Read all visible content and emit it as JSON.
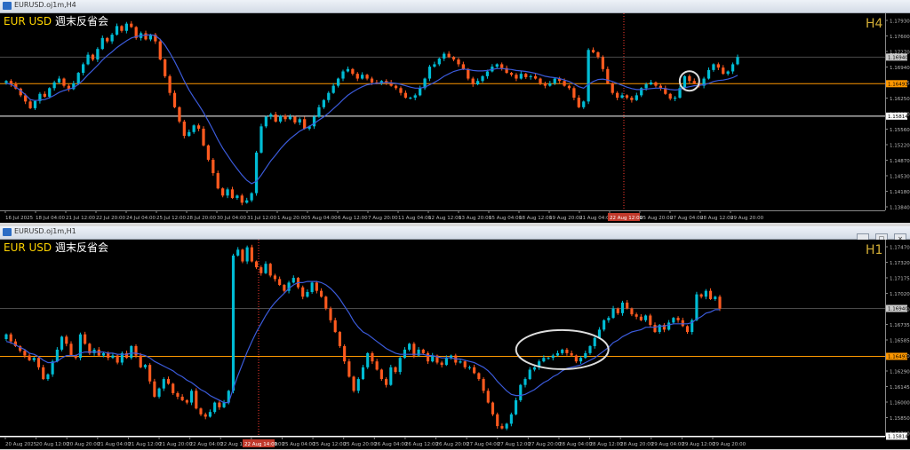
{
  "colors": {
    "background": "#000000",
    "bull": "#00bcd4",
    "bear": "#ff5a1f",
    "ma": "#3b5bdb",
    "hline_orange": "#ff9800",
    "hline_white": "#ffffff",
    "symbol_text": "#ffd400",
    "timeframe_text": "#d4af37"
  },
  "icons": {
    "window_minimize": "minimize-icon",
    "window_restore": "restore-icon",
    "window_close": "close-icon"
  },
  "top_window": {
    "title": "EURUSD.oj1m,H4",
    "symbol": "EUR USD",
    "subtitle": "週末反省会",
    "timeframe": "H4"
  },
  "bottom_window": {
    "title": "EURUSD.oj1m,H1",
    "symbol": "EUR USD",
    "subtitle": "週末反省会",
    "timeframe": "H1",
    "buttons": [
      "_",
      "□",
      "×"
    ]
  },
  "chart_data": [
    {
      "type": "candlestick",
      "timeframe": "H4",
      "ylim": [
        1.1384,
        1.1793
      ],
      "y_ticks": [
        "1.17930",
        "1.17600",
        "1.17270",
        "1.16940",
        "1.16605",
        "1.16250",
        "1.15920",
        "1.15560",
        "1.15220",
        "1.14870",
        "1.14530",
        "1.14180",
        "1.13840"
      ],
      "x_labels": [
        "16 Jul 2025",
        "18 Jul 04:00",
        "21 Jul 12:00",
        "22 Jul 20:00",
        "24 Jul 04:00",
        "25 Jul 12:00",
        "28 Jul 20:00",
        "30 Jul 04:00",
        "31 Jul 12:00",
        "1 Aug 20:00",
        "5 Aug 04:00",
        "6 Aug 12:00",
        "7 Aug 20:00",
        "11 Aug 04:00",
        "12 Aug 12:00",
        "13 Aug 20:00",
        "15 Aug 04:00",
        "18 Aug 12:00",
        "19 Aug 20:00",
        "21 Aug 04:00",
        "22 Aug 12:00",
        "25 Aug 20:00",
        "27 Aug 04:00",
        "28 Aug 12:00",
        "29 Aug 20:00"
      ],
      "x_highlight_label": "22 Aug 12:00",
      "price_labels": {
        "current": "1.16940",
        "orange_level": "1.16493",
        "white_level": "1.15814"
      },
      "levels": {
        "orange": 1.16493,
        "white": 1.15814
      },
      "close": [
        1.1655,
        1.1648,
        1.1639,
        1.1625,
        1.1612,
        1.1598,
        1.1613,
        1.1628,
        1.1622,
        1.164,
        1.1652,
        1.166,
        1.1645,
        1.1638,
        1.165,
        1.1672,
        1.169,
        1.171,
        1.17,
        1.1722,
        1.1745,
        1.1738,
        1.1752,
        1.177,
        1.176,
        1.1775,
        1.1768,
        1.1745,
        1.1755,
        1.1742,
        1.1752,
        1.1738,
        1.17,
        1.1665,
        1.163,
        1.16,
        1.157,
        1.154,
        1.1548,
        1.1562,
        1.1555,
        1.152,
        1.149,
        1.1462,
        1.143,
        1.1415,
        1.1428,
        1.141,
        1.1415,
        1.14,
        1.1405,
        1.142,
        1.1505,
        1.156,
        1.158,
        1.1585,
        1.157,
        1.1582,
        1.1575,
        1.158,
        1.1568,
        1.1575,
        1.1555,
        1.156,
        1.158,
        1.16,
        1.1615,
        1.163,
        1.1645,
        1.166,
        1.1675,
        1.168,
        1.167,
        1.166,
        1.1668,
        1.166,
        1.1652,
        1.165,
        1.1655,
        1.1652,
        1.1645,
        1.164,
        1.163,
        1.162,
        1.162,
        1.1625,
        1.164,
        1.166,
        1.1685,
        1.169,
        1.1702,
        1.1712,
        1.1705,
        1.17,
        1.169,
        1.168,
        1.166,
        1.1648,
        1.1655,
        1.1665,
        1.1675,
        1.1685,
        1.169,
        1.1682,
        1.1672,
        1.1668,
        1.166,
        1.167,
        1.1663,
        1.1665,
        1.166,
        1.165,
        1.1645,
        1.165,
        1.166,
        1.1655,
        1.1645,
        1.164,
        1.162,
        1.16,
        1.1612,
        1.172,
        1.1715,
        1.1705,
        1.168,
        1.165,
        1.163,
        1.162,
        1.1625,
        1.162,
        1.1615,
        1.1625,
        1.164,
        1.1648,
        1.1652,
        1.1645,
        1.164,
        1.1628,
        1.1618,
        1.162,
        1.164,
        1.1665,
        1.1655,
        1.165,
        1.1645,
        1.166,
        1.1678,
        1.169,
        1.1683,
        1.167,
        1.1675,
        1.169,
        1.1705
      ],
      "ma": [
        1.165,
        1.1648,
        1.1642,
        1.1635,
        1.1626,
        1.1616,
        1.1614,
        1.1615,
        1.1616,
        1.162,
        1.1625,
        1.1631,
        1.1635,
        1.1638,
        1.1641,
        1.1648,
        1.1657,
        1.1668,
        1.1678,
        1.1688,
        1.1699,
        1.1708,
        1.1716,
        1.1725,
        1.1732,
        1.1739,
        1.1745,
        1.1748,
        1.175,
        1.1751,
        1.1752,
        1.175,
        1.1742,
        1.173,
        1.1714,
        1.1696,
        1.1676,
        1.1655,
        1.1636,
        1.162,
        1.1605,
        1.1589,
        1.1571,
        1.1552,
        1.1532,
        1.1514,
        1.1499,
        1.1484,
        1.1471,
        1.1458,
        1.1447,
        1.144,
        1.1445,
        1.1458,
        1.1473,
        1.1488,
        1.15,
        1.1513,
        1.1524,
        1.1534,
        1.1542,
        1.155,
        1.1555,
        1.156,
        1.1566,
        1.1573,
        1.158,
        1.1588,
        1.1597,
        1.1606,
        1.1616,
        1.1625,
        1.1632,
        1.1638,
        1.1643,
        1.1647,
        1.1649,
        1.165,
        1.1651,
        1.1652,
        1.1651,
        1.165,
        1.1648,
        1.1645,
        1.1642,
        1.164,
        1.164,
        1.1642,
        1.1647,
        1.1652,
        1.1658,
        1.1665,
        1.167,
        1.1675,
        1.1678,
        1.168,
        1.1679,
        1.1677,
        1.1676,
        1.1676,
        1.1677,
        1.1679,
        1.1681,
        1.1681,
        1.168,
        1.1679,
        1.1677,
        1.1676,
        1.1675,
        1.1673,
        1.1671,
        1.1668,
        1.1665,
        1.1663,
        1.1662,
        1.166,
        1.1657,
        1.1654,
        1.1649,
        1.1643,
        1.164,
        1.1648,
        1.1654,
        1.1658,
        1.1659,
        1.1657,
        1.1654,
        1.165,
        1.1646,
        1.1642,
        1.1639,
        1.1637,
        1.1637,
        1.1638,
        1.1639,
        1.164,
        1.164,
        1.1639,
        1.1637,
        1.1636,
        1.1637,
        1.1641,
        1.1643,
        1.1645,
        1.1646,
        1.1647,
        1.165,
        1.1654,
        1.1656,
        1.1657,
        1.1659,
        1.1662,
        1.1667
      ],
      "annotation": "circle"
    },
    {
      "type": "candlestick",
      "timeframe": "H1",
      "ylim": [
        1.1581,
        1.1747
      ],
      "y_ticks": [
        "1.17470",
        "1.17320",
        "1.17175",
        "1.17020",
        "1.16880",
        "1.16735",
        "1.16585",
        "1.16440",
        "1.16290",
        "1.16145",
        "1.16000",
        "1.15850",
        "1.15700"
      ],
      "x_labels": [
        "20 Aug 2025",
        "20 Aug 12:00",
        "20 Aug 20:00",
        "21 Aug 04:00",
        "21 Aug 12:00",
        "21 Aug 20:00",
        "22 Aug 04:00",
        "22 Aug 12:00",
        "22 Aug 20:00",
        "25 Aug 04:00",
        "25 Aug 12:00",
        "25 Aug 20:00",
        "26 Aug 04:00",
        "26 Aug 12:00",
        "26 Aug 20:00",
        "27 Aug 04:00",
        "27 Aug 12:00",
        "27 Aug 20:00",
        "28 Aug 04:00",
        "28 Aug 12:00",
        "28 Aug 20:00",
        "29 Aug 04:00",
        "29 Aug 12:00",
        "29 Aug 20:00"
      ],
      "x_highlight_label": "22 Aug 14:00",
      "price_labels": {
        "current": "1.16940",
        "orange_level": "1.16493",
        "white_level": "1.15814"
      },
      "levels": {
        "orange": 1.16493,
        "white": 1.15814
      },
      "close": [
        1.1668,
        1.1662,
        1.1658,
        1.1654,
        1.165,
        1.1646,
        1.1648,
        1.164,
        1.163,
        1.1634,
        1.1645,
        1.1655,
        1.1666,
        1.166,
        1.165,
        1.1648,
        1.1668,
        1.166,
        1.1652,
        1.1655,
        1.165,
        1.1652,
        1.1648,
        1.165,
        1.1644,
        1.1652,
        1.1648,
        1.1658,
        1.165,
        1.164,
        1.1642,
        1.1628,
        1.1615,
        1.1622,
        1.163,
        1.1626,
        1.1618,
        1.1615,
        1.1612,
        1.161,
        1.162,
        1.1605,
        1.16,
        1.1598,
        1.1602,
        1.161,
        1.1606,
        1.161,
        1.162,
        1.1735,
        1.174,
        1.173,
        1.1742,
        1.173,
        1.1725,
        1.172,
        1.1728,
        1.1718,
        1.1715,
        1.171,
        1.1705,
        1.1712,
        1.1716,
        1.1708,
        1.17,
        1.1704,
        1.1712,
        1.1705,
        1.17,
        1.169,
        1.168,
        1.167,
        1.1658,
        1.1645,
        1.1632,
        1.162,
        1.163,
        1.164,
        1.1652,
        1.1645,
        1.1638,
        1.163,
        1.1625,
        1.164,
        1.1636,
        1.1648,
        1.1655,
        1.166,
        1.165,
        1.1655,
        1.1652,
        1.1645,
        1.165,
        1.1644,
        1.1642,
        1.1648,
        1.165,
        1.1644,
        1.1645,
        1.164,
        1.164,
        1.1635,
        1.163,
        1.162,
        1.161,
        1.16,
        1.159,
        1.1588,
        1.1592,
        1.16,
        1.1612,
        1.1625,
        1.163,
        1.1638,
        1.164,
        1.1645,
        1.1648,
        1.1648,
        1.165,
        1.1652,
        1.1655,
        1.1652,
        1.165,
        1.1645,
        1.1648,
        1.1652,
        1.1658,
        1.1665,
        1.1672,
        1.168,
        1.1682,
        1.169,
        1.1686,
        1.1695,
        1.169,
        1.1685,
        1.1683,
        1.168,
        1.1684,
        1.1676,
        1.167,
        1.1676,
        1.1672,
        1.1678,
        1.1682,
        1.168,
        1.1675,
        1.167,
        1.168,
        1.1702,
        1.17,
        1.1705,
        1.1698,
        1.17,
        1.169
      ],
      "ma": [
        1.1662,
        1.1661,
        1.1659,
        1.1657,
        1.1655,
        1.1652,
        1.1651,
        1.1649,
        1.1646,
        1.1644,
        1.1644,
        1.1645,
        1.1648,
        1.165,
        1.165,
        1.165,
        1.1652,
        1.1653,
        1.1653,
        1.1653,
        1.1653,
        1.1653,
        1.1652,
        1.1652,
        1.1651,
        1.1651,
        1.1651,
        1.1652,
        1.1652,
        1.1651,
        1.165,
        1.1648,
        1.1645,
        1.1643,
        1.1641,
        1.1639,
        1.1637,
        1.1634,
        1.1632,
        1.1629,
        1.1627,
        1.1624,
        1.1621,
        1.1619,
        1.1616,
        1.1614,
        1.1612,
        1.161,
        1.161,
        1.1622,
        1.1633,
        1.1643,
        1.1653,
        1.1662,
        1.167,
        1.1677,
        1.1684,
        1.169,
        1.1695,
        1.1699,
        1.1703,
        1.1707,
        1.171,
        1.1712,
        1.1712,
        1.1713,
        1.1713,
        1.1713,
        1.1712,
        1.171,
        1.1707,
        1.1703,
        1.1698,
        1.1692,
        1.1686,
        1.1679,
        1.1674,
        1.167,
        1.1668,
        1.1665,
        1.1662,
        1.1659,
        1.1656,
        1.1654,
        1.1652,
        1.1651,
        1.1651,
        1.1651,
        1.1651,
        1.1651,
        1.1651,
        1.165,
        1.165,
        1.1649,
        1.1648,
        1.1648,
        1.1648,
        1.1647,
        1.1647,
        1.1646,
        1.1645,
        1.1644,
        1.1642,
        1.164,
        1.1637,
        1.1633,
        1.1628,
        1.1624,
        1.162,
        1.1617,
        1.1616,
        1.1616,
        1.1617,
        1.1619,
        1.1621,
        1.1624,
        1.1627,
        1.1629,
        1.1632,
        1.1634,
        1.1637,
        1.1639,
        1.164,
        1.1641,
        1.1642,
        1.1644,
        1.1646,
        1.1648,
        1.1651,
        1.1654,
        1.1657,
        1.1661,
        1.1663,
        1.1666,
        1.1668,
        1.167,
        1.1671,
        1.1672,
        1.1674,
        1.1674,
        1.1674,
        1.1675,
        1.1675,
        1.1676,
        1.1677,
        1.1677,
        1.1677,
        1.1677,
        1.1678,
        1.1681,
        1.1683,
        1.1686,
        1.1687,
        1.1689,
        1.1689
      ],
      "annotation": "ellipse"
    }
  ]
}
